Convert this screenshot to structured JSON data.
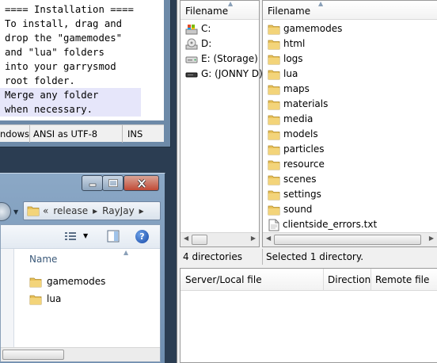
{
  "editor": {
    "lines": [
      "==== Installation ====",
      "To install, drag and",
      "drop the \"gamemodes\"",
      "and \"lua\" folders",
      "into your garrysmod",
      "root folder.",
      "Merge any folder",
      "when necessary."
    ],
    "status": {
      "eol": "ndows",
      "encoding": "ANSI as UTF-8",
      "mode": "INS"
    }
  },
  "explorer": {
    "breadcrumb": [
      "«",
      "release",
      "▸",
      "RayJay",
      "▸"
    ],
    "column_name": "Name",
    "items": [
      "gamemodes",
      "lua"
    ],
    "help_glyph": "?"
  },
  "ftp": {
    "local": {
      "header": "Filename",
      "drives": [
        {
          "label": "C:",
          "icon": "windows-drive-icon"
        },
        {
          "label": "D:",
          "icon": "optical-drive-icon"
        },
        {
          "label": "E: (Storage)",
          "icon": "hard-drive-icon"
        },
        {
          "label": "G: (JONNY D)",
          "icon": "usb-drive-icon"
        }
      ],
      "status": "4 directories"
    },
    "remote": {
      "header": "Filename",
      "folders": [
        "gamemodes",
        "html",
        "logs",
        "lua",
        "maps",
        "materials",
        "media",
        "models",
        "particles",
        "resource",
        "scenes",
        "settings",
        "sound"
      ],
      "files": [
        "clientside_errors.txt"
      ],
      "status": "Selected 1 directory."
    },
    "queue": {
      "columns": [
        "Server/Local file",
        "Direction",
        "Remote file"
      ]
    }
  },
  "colors": {
    "folder": "#e8c15a",
    "selection": "#e6e6fa",
    "desktop": "#2b3d52",
    "close_button": "#c14a36"
  }
}
